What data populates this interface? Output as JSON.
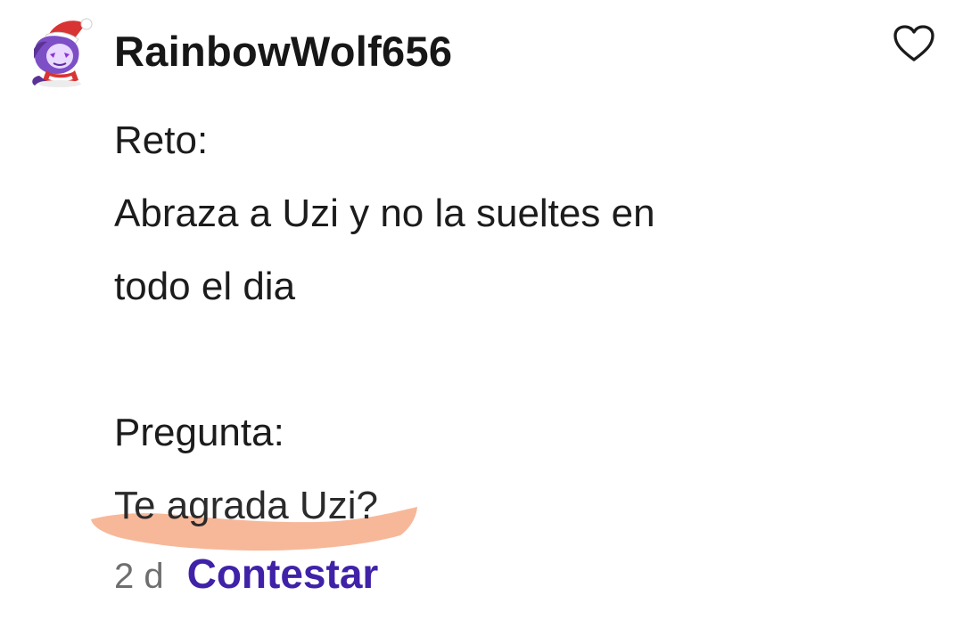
{
  "comment": {
    "username": "RainbowWolf656",
    "lines": [
      "Reto:",
      "Abraza a Uzi y no la sueltes en",
      "todo el dia",
      "",
      "Pregunta:",
      "Te agrada Uzi?"
    ],
    "time": "2 d",
    "reply_label": "Contestar"
  },
  "icons": {
    "avatar": "santa-hat-avatar-icon",
    "like": "heart-outline-icon"
  },
  "colors": {
    "reply": "#3f22a8",
    "highlight": "#f6b08f"
  }
}
